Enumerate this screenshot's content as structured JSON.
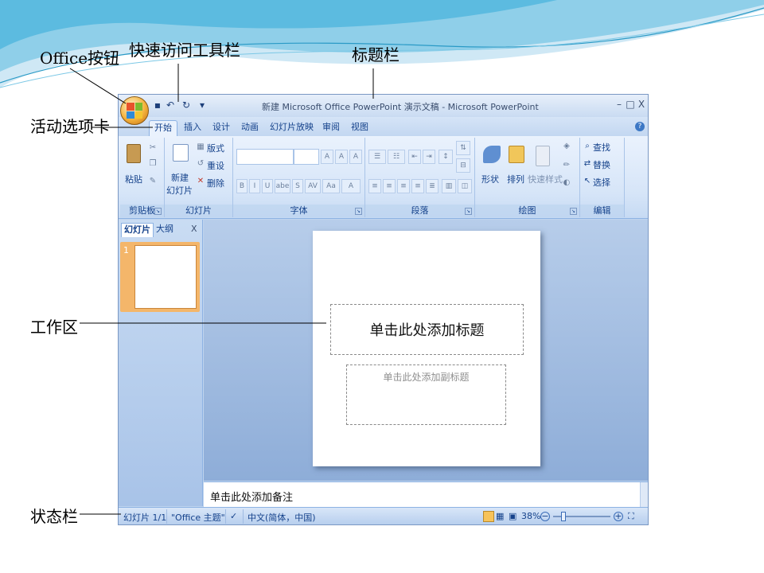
{
  "callouts": {
    "office_button": "Office按钮",
    "quick_access": "快速访问工具栏",
    "title_bar": "标题栏",
    "active_tab": "活动选项卡",
    "work_area": "工作区",
    "status_bar": "状态栏"
  },
  "window": {
    "title": "新建 Microsoft Office PowerPoint 演示文稿 - Microsoft PowerPoint",
    "controls": {
      "minimize": "–",
      "maximize": "□",
      "close": "X"
    }
  },
  "quick_access": {
    "save": "▪",
    "undo": "↶",
    "redo": "↻",
    "more": "▾"
  },
  "tabs": [
    {
      "label": "开始",
      "active": true
    },
    {
      "label": "插入"
    },
    {
      "label": "设计"
    },
    {
      "label": "动画"
    },
    {
      "label": "幻灯片放映"
    },
    {
      "label": "审阅"
    },
    {
      "label": "视图"
    }
  ],
  "ribbon": {
    "clipboard": {
      "label": "剪贴板",
      "paste": "粘贴"
    },
    "slides": {
      "label": "幻灯片",
      "new_slide_1": "新建",
      "new_slide_2": "幻灯片",
      "layout": "版式",
      "reset": "重设",
      "delete": "删除"
    },
    "font": {
      "label": "字体",
      "grow": "A",
      "shrink": "A",
      "clear": "A",
      "bold": "B",
      "italic": "I",
      "underline": "U",
      "strike": "abe",
      "shadow": "S",
      "spacing": "AV",
      "case": "Aa",
      "color": "A"
    },
    "paragraph": {
      "label": "段落"
    },
    "drawing": {
      "label": "绘图",
      "shapes": "形状",
      "arrange": "排列",
      "quick_styles": "快速样式"
    },
    "editing": {
      "label": "编辑",
      "find": "查找",
      "replace": "替换",
      "select": "选择"
    }
  },
  "panel": {
    "tabs": [
      "幻灯片",
      "大纲"
    ],
    "close": "X",
    "slide_number": "1"
  },
  "slide": {
    "title_placeholder": "单击此处添加标题",
    "subtitle_placeholder": "单击此处添加副标题"
  },
  "notes": {
    "placeholder": "单击此处添加备注"
  },
  "status": {
    "slide_count": "幻灯片 1/1",
    "theme": "\"Office 主题\"",
    "language": "中文(简体，中国)",
    "zoom": "38%",
    "zoom_out": "−",
    "zoom_in": "+"
  },
  "colors": {
    "accent": "#15428b",
    "ribbon": "#dbe7f8",
    "office_button": "#f3b23c"
  }
}
